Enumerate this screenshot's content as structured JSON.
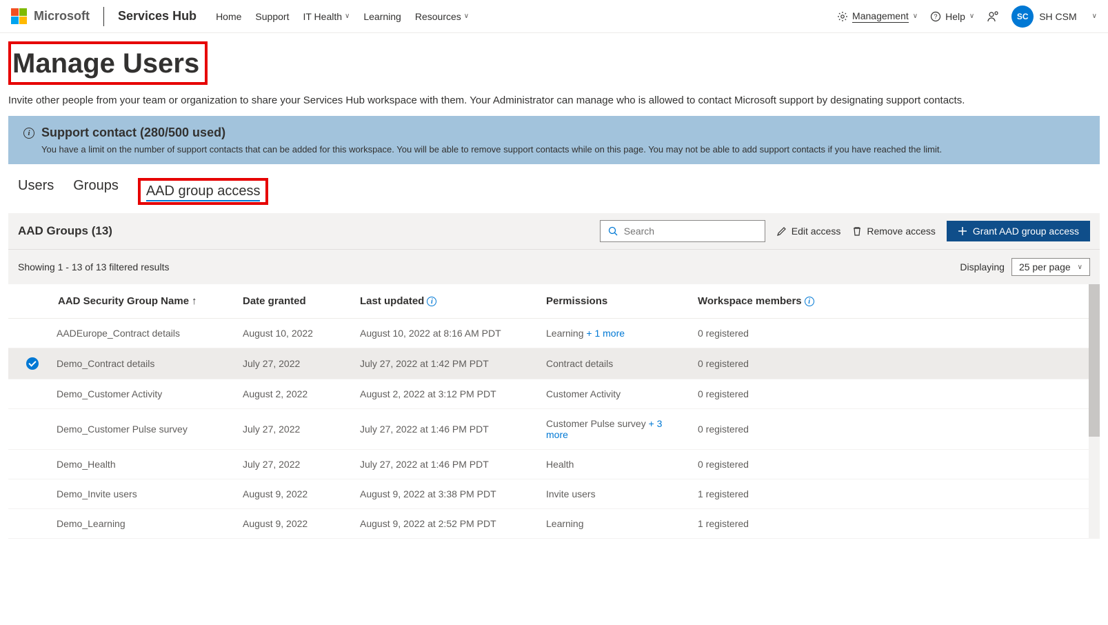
{
  "header": {
    "brand": "Microsoft",
    "product": "Services Hub",
    "nav": [
      "Home",
      "Support",
      "IT Health",
      "Learning",
      "Resources"
    ],
    "management": "Management",
    "help": "Help",
    "user_initials": "SC",
    "user_name": "SH CSM"
  },
  "page": {
    "title": "Manage Users",
    "subtitle": "Invite other people from your team or organization to share your Services Hub workspace with them. Your Administrator can manage who is allowed to contact Microsoft support by designating support contacts."
  },
  "banner": {
    "title": "Support contact (280/500 used)",
    "body": "You have a limit on the number of support contacts that can be added for this workspace. You will be able to remove support contacts while on this page. You may not be able to add support contacts if you have reached the limit."
  },
  "tabs": {
    "users": "Users",
    "groups": "Groups",
    "aad": "AAD group access"
  },
  "toolbar": {
    "title": "AAD Groups (13)",
    "search_placeholder": "Search",
    "edit": "Edit access",
    "remove": "Remove access",
    "grant": "Grant AAD group access"
  },
  "filter": {
    "results": "Showing 1 - 13 of 13 filtered results",
    "displaying": "Displaying",
    "per_page": "25 per page"
  },
  "columns": {
    "name": "AAD Security Group Name",
    "date": "Date granted",
    "updated": "Last updated",
    "perm": "Permissions",
    "members": "Workspace members"
  },
  "rows": [
    {
      "selected": false,
      "name": "AADEurope_Contract details",
      "date": "August 10, 2022",
      "updated": "August 10, 2022 at 8:16 AM PDT",
      "perm": "Learning",
      "perm_more": "+ 1 more",
      "members": "0 registered"
    },
    {
      "selected": true,
      "name": "Demo_Contract details",
      "date": "July 27, 2022",
      "updated": "July 27, 2022 at 1:42 PM PDT",
      "perm": "Contract details",
      "perm_more": "",
      "members": "0 registered"
    },
    {
      "selected": false,
      "name": "Demo_Customer Activity",
      "date": "August 2, 2022",
      "updated": "August 2, 2022 at 3:12 PM PDT",
      "perm": "Customer Activity",
      "perm_more": "",
      "members": "0 registered"
    },
    {
      "selected": false,
      "name": "Demo_Customer Pulse survey",
      "date": "July 27, 2022",
      "updated": "July 27, 2022 at 1:46 PM PDT",
      "perm": "Customer Pulse survey",
      "perm_more": "+ 3 more",
      "members": "0 registered"
    },
    {
      "selected": false,
      "name": "Demo_Health",
      "date": "July 27, 2022",
      "updated": "July 27, 2022 at 1:46 PM PDT",
      "perm": "Health",
      "perm_more": "",
      "members": "0 registered"
    },
    {
      "selected": false,
      "name": "Demo_Invite users",
      "date": "August 9, 2022",
      "updated": "August 9, 2022 at 3:38 PM PDT",
      "perm": "Invite users",
      "perm_more": "",
      "members": "1 registered"
    },
    {
      "selected": false,
      "name": "Demo_Learning",
      "date": "August 9, 2022",
      "updated": "August 9, 2022 at 2:52 PM PDT",
      "perm": "Learning",
      "perm_more": "",
      "members": "1 registered"
    }
  ]
}
